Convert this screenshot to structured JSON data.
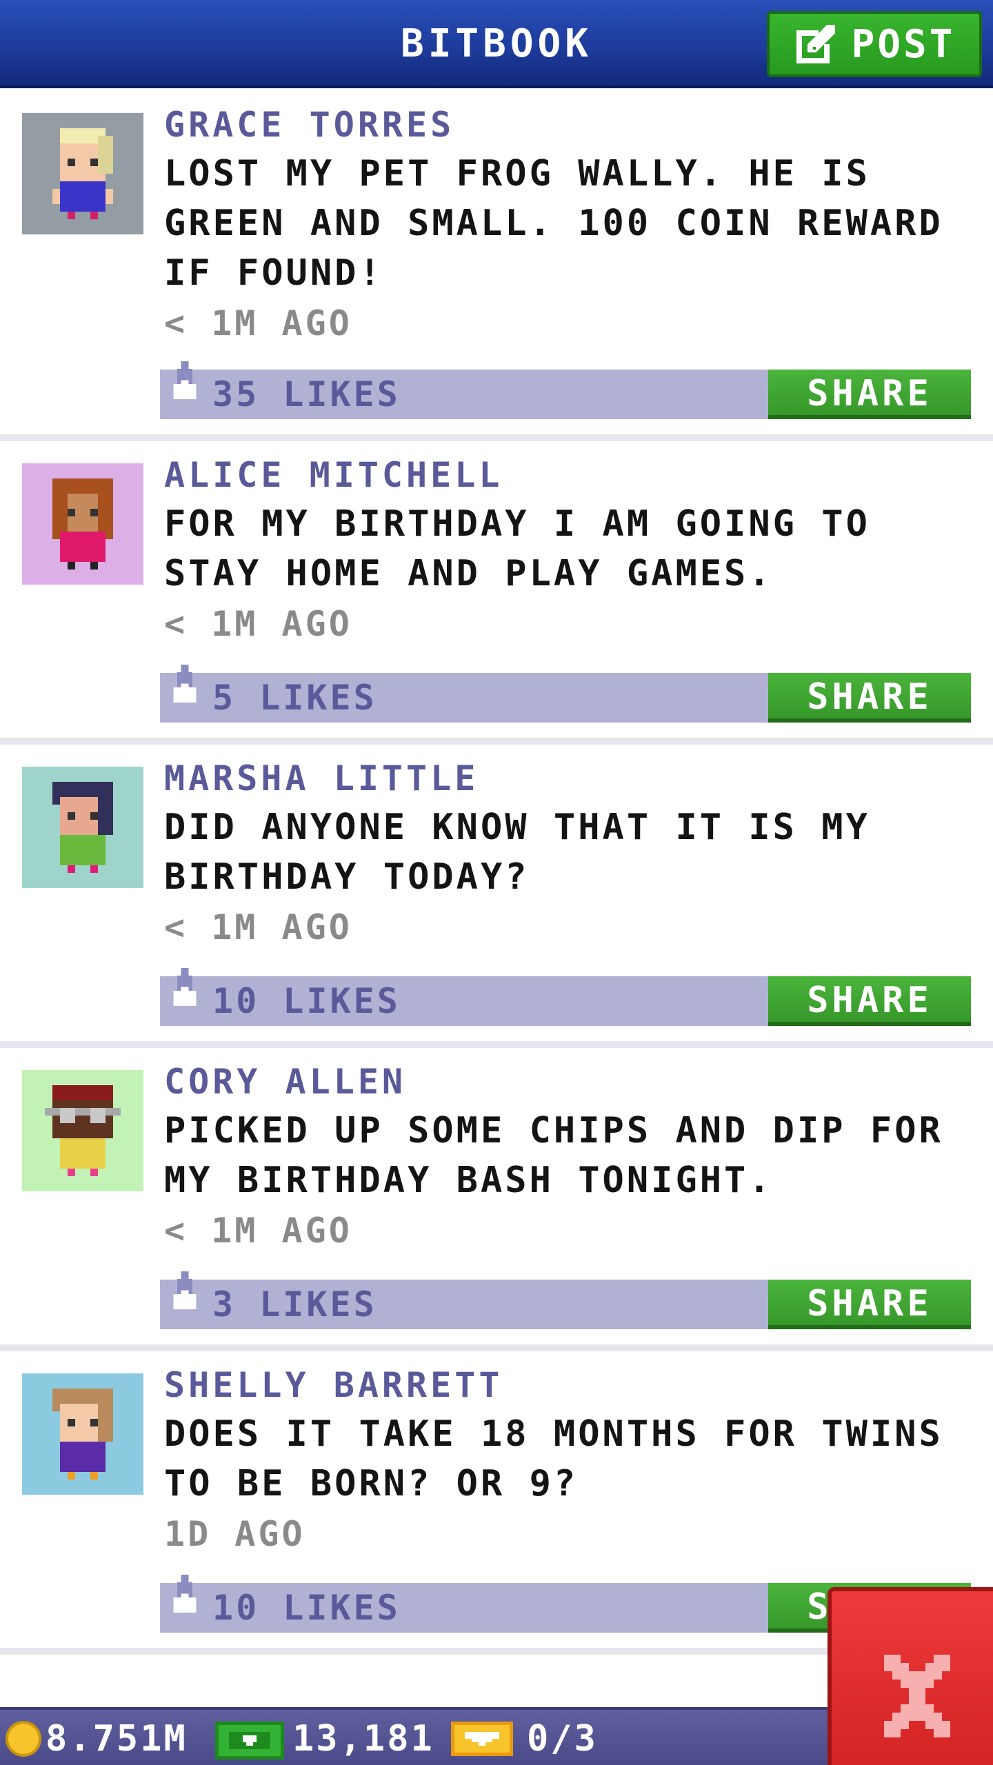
{
  "app": {
    "title": "BITBOOK",
    "post_label": "POST"
  },
  "posts": [
    {
      "author": "GRACE TORRES",
      "message": "LOST MY PET FROG WALLY. HE IS GREEN AND SMALL. 100 COIN REWARD IF FOUND!",
      "time": "< 1M AGO",
      "likes": "35 LIKES",
      "share_label": "SHARE",
      "avatar_bg": "#949ca4"
    },
    {
      "author": "ALICE MITCHELL",
      "message": "FOR MY BIRTHDAY I AM GOING TO STAY HOME AND PLAY GAMES.",
      "time": "< 1M AGO",
      "likes": "5 LIKES",
      "share_label": "SHARE",
      "avatar_bg": "#dcb0e6"
    },
    {
      "author": "MARSHA LITTLE",
      "message": "DID ANYONE KNOW THAT IT IS MY BIRTHDAY TODAY?",
      "time": "< 1M AGO",
      "likes": "10 LIKES",
      "share_label": "SHARE",
      "avatar_bg": "#9ed4ca"
    },
    {
      "author": "CORY ALLEN",
      "message": "PICKED UP SOME CHIPS AND DIP FOR MY BIRTHDAY BASH TONIGHT.",
      "time": "< 1M AGO",
      "likes": "3 LIKES",
      "share_label": "SHARE",
      "avatar_bg": "#c2f2b6"
    },
    {
      "author": "SHELLY BARRETT",
      "message": "DOES IT TAKE 18 MONTHS FOR TWINS TO BE BORN? OR 9?",
      "time": "1D AGO",
      "likes": "10 LIKES",
      "share_label": "SHARE",
      "avatar_bg": "#8ccae0"
    }
  ],
  "status": {
    "coins": "8.751M",
    "bux": "13,181",
    "tickets": "0/3"
  },
  "colors": {
    "header": "#1d3c9c",
    "accent_green": "#36982a",
    "action_bar": "#b1b1d4",
    "author_text": "#5a5a9a",
    "close_red": "#d42424"
  },
  "icons": [
    "edit-icon",
    "like-icon",
    "coin-icon",
    "bux-icon",
    "ticket-icon",
    "close-icon"
  ]
}
